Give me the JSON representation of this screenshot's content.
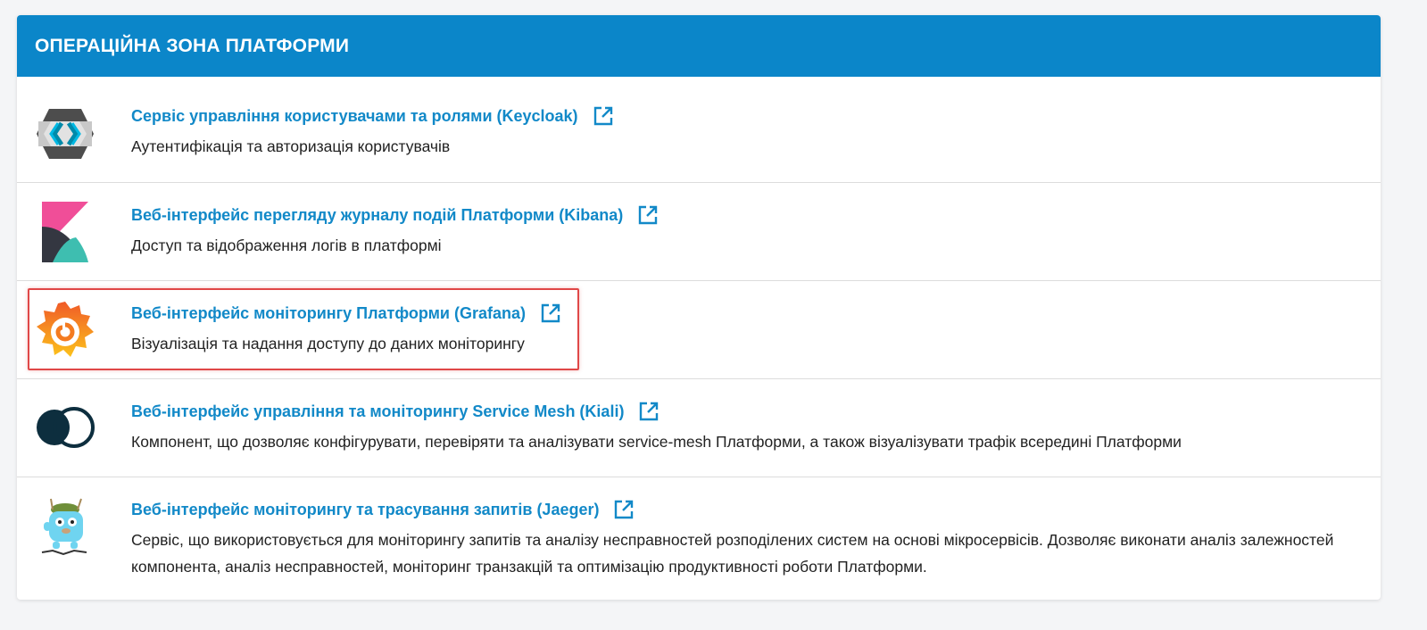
{
  "section": {
    "title": "ОПЕРАЦІЙНА ЗОНА ПЛАТФОРМИ",
    "accent": "#0b86c9",
    "link_color": "#1289c8",
    "highlight_color": "#e04848"
  },
  "services": [
    {
      "title": "Сервіс управління користувачами та ролями (Keycloak)",
      "description": "Аутентифікація та авторизація користувачів",
      "icon": "keycloak-logo",
      "link_icon": "external-link-icon"
    },
    {
      "title": "Веб-інтерфейс перегляду журналу подій Платформи (Kibana)",
      "description": "Доступ та відображення логів в платформі",
      "icon": "kibana-logo",
      "link_icon": "external-link-icon"
    },
    {
      "title": "Веб-інтерфейс моніторингу Платформи (Grafana)",
      "description": "Візуалізація та надання доступу до даних моніторингу",
      "icon": "grafana-logo",
      "link_icon": "external-link-icon",
      "highlighted": true
    },
    {
      "title": "Веб-інтерфейс управління та моніторингу Service Mesh (Kiali)",
      "description": "Компонент, що дозволяє конфігурувати, перевіряти та аналізувати service-mesh Платформи, а також візуалізувати трафік всередині Платформи",
      "icon": "kiali-logo",
      "link_icon": "external-link-icon"
    },
    {
      "title": "Веб-інтерфейс моніторингу та трасування запитів (Jaeger)",
      "description": "Сервіс, що використовується для моніторингу запитів та аналізу несправностей розподілених систем на основі мікросервісів. Дозволяє виконати аналіз залежностей компонента, аналіз несправностей, моніторинг транзакцій та оптимізацію продуктивності роботи Платформи.",
      "icon": "jaeger-logo",
      "link_icon": "external-link-icon"
    }
  ]
}
